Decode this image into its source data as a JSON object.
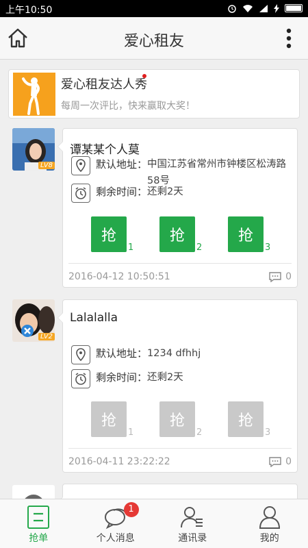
{
  "status_bar": {
    "time": "上午10:50"
  },
  "header": {
    "title": "爱心租友"
  },
  "banner": {
    "title": "爱心租友达人秀",
    "subtitle": "每周一次评比，快来赢取大奖！"
  },
  "posts": [
    {
      "name": "谭某某个人莫",
      "level": "LV8",
      "address_label": "默认地址：",
      "address": "中国江苏省常州市钟楼区松涛路58号",
      "time_label": "剩余时间：",
      "time_left": "还剩2天",
      "grab_label": "抢",
      "grabs": [
        "1",
        "2",
        "3"
      ],
      "grab_enabled": true,
      "date": "2016-04-12 10:50:51",
      "comments": "0"
    },
    {
      "name": "Lalalalla",
      "level": "LV2",
      "address_label": "默认地址：",
      "address": "1234 dfhhj",
      "time_label": "剩余时间：",
      "time_left": "还剩2天",
      "grab_label": "抢",
      "grabs": [
        "1",
        "2",
        "3"
      ],
      "grab_enabled": false,
      "date": "2016-04-11 23:22:22",
      "comments": "0"
    }
  ],
  "tabs": [
    {
      "label": "抢单",
      "active": true
    },
    {
      "label": "个人消息",
      "badge": "1"
    },
    {
      "label": "通讯录"
    },
    {
      "label": "我的"
    }
  ],
  "colors": {
    "accent": "#24a84a",
    "banner_bg": "#f6a11d",
    "badge": "#e53935",
    "disabled": "#c9c9c9"
  }
}
